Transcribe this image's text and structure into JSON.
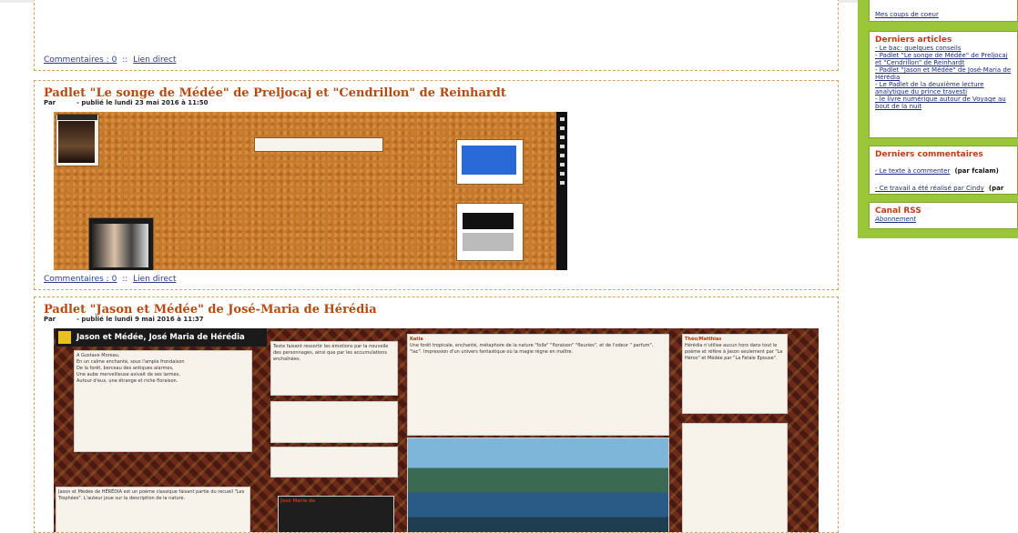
{
  "posts": {
    "top": {
      "comments_label": "Commentaires : 0",
      "separator": "::",
      "direct_link_label": "Lien direct"
    },
    "songe": {
      "title": "Padlet \"Le songe de Médée\" de Preljocaj et \"Cendrillon\" de Reinhardt",
      "meta_prefix": "Par",
      "meta_date": "- publié le lundi 23 mai 2016 à 11:50",
      "comments_label": "Commentaires : 0",
      "separator": "::",
      "direct_link_label": "Lien direct"
    },
    "jason": {
      "title": "Padlet \"Jason et Médée\" de José-Maria de Hérédia",
      "meta_prefix": "Par",
      "meta_date": "- publié le lundi 9 mai 2016 à 11:37",
      "padlet_header": "Jason et Médée, José Maria de Hérédia",
      "notes": {
        "poem": "A Gustave Moreau.\nEn un calme enchanté, sous l'ample frondaison\nDe la forêt, berceau des antiques alarmes,\nUne aube merveilleuse avivait de ses larmes,\nAutour d'eux, une étrange et riche floraison.",
        "emotions": "Texte faisant ressortir les émotions par la nouvelle des personnages, ainsi que par les accumulations enchaînées.",
        "katia_author": "Katia",
        "katia_text": "Une forêt tropicale, enchanté, métaphore de la nature \"folle\" \"floraison\" \"fleuries\", et de l'odeur \" parfum\". \"lac\". Impression d'un univers fantastique où la magie règne en maître.",
        "theo_author": "Théo/Matthias",
        "theo_text": "Hérédia n'utilise aucun hors dans tout le poème et réfère à Jason seulement par \"Le Héros\" et Médée par \"La Fatale Epouse\".",
        "bottom_left": "Jason et Médée de HÉRÉDIA est un poème classique faisant partie du recueil \"Les Trophées\". L'auteur joue sur la description de la nature.",
        "bottom_mid_author": "José Maria de"
      }
    }
  },
  "sidebar": {
    "top_link": "Mes coups de coeur",
    "derniers_articles": {
      "title": "Derniers articles",
      "items": [
        "- Le bac: quelques conseils",
        "- Padlet \"Le songe de Médée\" de Preljocaj et \"Cendrillon\" de Reinhardt",
        "- Padlet \"Jason et Médée\" de José-Maria de Hérédia",
        "- Le Padlet de la deuxième lecture analytique du prince travesti",
        "- le livre numérique autour de Voyage au bout de la nuit"
      ]
    },
    "derniers_commentaires": {
      "title": "Derniers commentaires",
      "items": [
        {
          "link": "- Le texte à commenter",
          "suffix": "(par fcalam)"
        },
        {
          "link": "- Ce travail a été réalisé par Cindy",
          "suffix": "(par fcalam)"
        }
      ]
    },
    "canal_rss": {
      "title": "Canal RSS",
      "link": "Abonnement"
    }
  },
  "colors": {
    "title_orange": "#b84a10",
    "link_blue": "#2a3d8a",
    "sidebar_green": "#9cc63a",
    "sidebar_title_red": "#c63a12"
  }
}
